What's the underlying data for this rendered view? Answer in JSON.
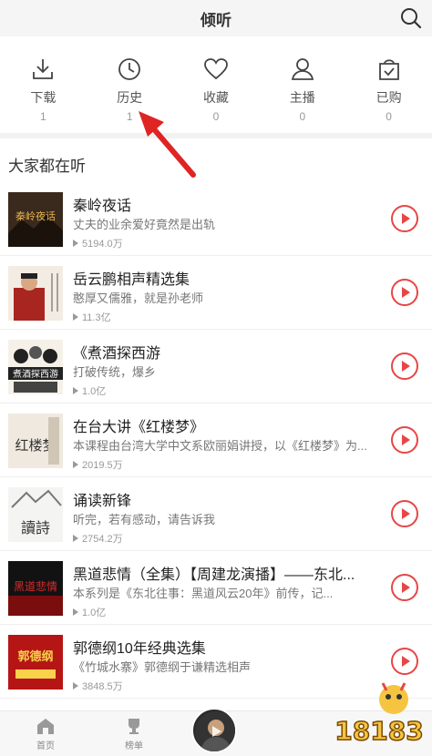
{
  "header": {
    "title": "倾听"
  },
  "nav": [
    {
      "label": "下载",
      "count": "1",
      "icon": "download-icon"
    },
    {
      "label": "历史",
      "count": "1",
      "icon": "clock-icon"
    },
    {
      "label": "收藏",
      "count": "0",
      "icon": "heart-icon"
    },
    {
      "label": "主播",
      "count": "0",
      "icon": "user-icon"
    },
    {
      "label": "已购",
      "count": "0",
      "icon": "bag-check-icon"
    }
  ],
  "section": {
    "title": "大家都在听"
  },
  "items": [
    {
      "title": "秦岭夜话",
      "desc": "丈夫的业余爱好竟然是出轨",
      "plays": "5194.0万"
    },
    {
      "title": "岳云鹏相声精选集",
      "desc": "憨厚又儒雅，就是孙老师",
      "plays": "11.3亿"
    },
    {
      "title": "《煮酒探西游",
      "desc": "打破传统，爆乡",
      "plays": "1.0亿"
    },
    {
      "title": "在台大讲《红楼梦》",
      "desc": "本课程由台湾大学中文系欧丽娟讲授，以《红楼梦》为...",
      "plays": "2019.5万"
    },
    {
      "title": "诵读新锋",
      "desc": "听完，若有感动，请告诉我",
      "plays": "2754.2万"
    },
    {
      "title": "黑道悲情（全集）【周建龙演播】——东北...",
      "desc": "本系列是《东北往事：黑道风云20年》前传，记...",
      "plays": "1.0亿"
    },
    {
      "title": "郭德纲10年经典选集",
      "desc": "《竹城水寨》郭德纲于谦精选相声",
      "plays": "3848.5万"
    }
  ],
  "cover_text": {
    "c1": "秦岭夜话",
    "c3": "煮酒探西游",
    "c4": "红楼梦",
    "c5": "讀詩",
    "c6": "黑道悲情",
    "c7": "郭德纲"
  },
  "tabbar": {
    "home": "首页",
    "rank": "榜单"
  },
  "watermark": {
    "text": "18183"
  },
  "colors": {
    "accent": "#e84545",
    "arrow": "#e02424"
  }
}
